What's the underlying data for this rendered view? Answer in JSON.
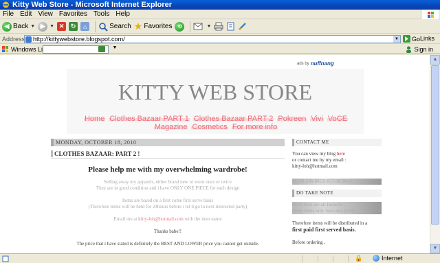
{
  "window": {
    "title": "Kitty Web Store - Microsoft Internet Explorer"
  },
  "menu": [
    "File",
    "Edit",
    "View",
    "Favorites",
    "Tools",
    "Help"
  ],
  "toolbar": {
    "back_label": "Back",
    "search_label": "Search",
    "favorites_label": "Favorites"
  },
  "address": {
    "label": "Address",
    "url": "http://kittywebstore.blogspot.com/",
    "go_label": "Go",
    "links_label": "Links"
  },
  "live": {
    "label": "Windows Live",
    "signin_label": "Sign in"
  },
  "page": {
    "ad_label": "ads by",
    "ad_brand": "nuffnang",
    "site_title": "KITTY WEB STORE",
    "nav_row1": [
      "Home",
      "Clothes Bazaar PART 1",
      "Clothes Bazaar PART 2",
      "Pokreen",
      "Vivi",
      "VoCE"
    ],
    "nav_row2": [
      "Magazine",
      "Cosmetics",
      "For more info"
    ],
    "post": {
      "date": "MONDAY, OCTOBER 18, 2010",
      "title": "CLOTHES BAZAAR: PART 2 !",
      "heading": "Please help me with my overwhelming wardrobe!",
      "line1": "Selling away my apparels, either brand new or worn once or twice",
      "line2": "They are in good condition and i have ONLY ONE PIECE for each design",
      "line3": "Items are based on a first come first serve basis",
      "line4": "(Therefore items will be held for 24hours before i let it go to next interested party)",
      "email_prefix": "Email me at ",
      "email": "kitty-loh@hotmail.com",
      "email_suffix": " with the item name",
      "thanks": "Thanks babe!!",
      "price_note": "The price that i have stated is definitely the BEST AND LOWER price you cannot get outside."
    },
    "sidebar": {
      "contact_head": "CONTACT ME",
      "contact_line1_prefix": "You can view my blog ",
      "contact_line1_link": "here",
      "contact_line2": "or contact me by my email :",
      "contact_email": "kitty-loh@hotmail.com",
      "posb": "POSB SAVINGS 057-36594-3",
      "note_head": "DO TAKE NOTE",
      "note_line1": "Items here are all Instocks ,",
      "note_line2": "every items only have one piece.",
      "note_line3": "Therefore items will be distributed in a",
      "note_line4": "first paid first served basis.",
      "note_line5": "Before ordering ,"
    }
  },
  "status": {
    "zone": "Internet"
  }
}
